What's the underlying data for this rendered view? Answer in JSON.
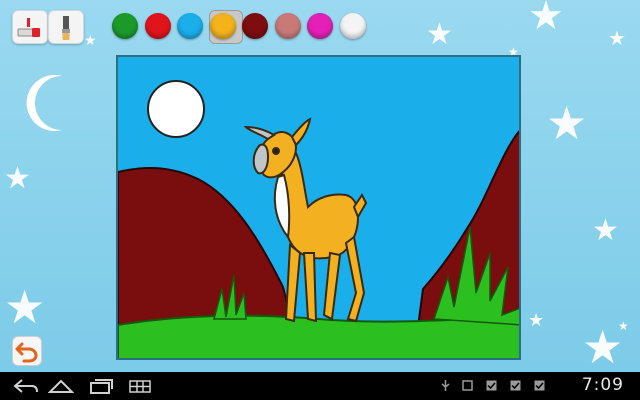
{
  "toolbar": {
    "tools": [
      {
        "name": "marker-tool",
        "icon": "marker-icon"
      },
      {
        "name": "brush-tool",
        "icon": "paint-brush-icon"
      }
    ],
    "palette": [
      {
        "name": "green",
        "color": "#1b9a2a"
      },
      {
        "name": "red",
        "color": "#e1141c"
      },
      {
        "name": "cyan",
        "color": "#1aaeea"
      },
      {
        "name": "yellow",
        "color": "#f4b21b",
        "selected": true
      },
      {
        "name": "maroon",
        "color": "#7d0d10"
      },
      {
        "name": "rose",
        "color": "#c97a78"
      },
      {
        "name": "magenta",
        "color": "#e321b8"
      },
      {
        "name": "white",
        "color": "#f4f4f4"
      }
    ]
  },
  "canvas": {
    "sky_color": "#1aaeea",
    "hill_color": "#7a0e0e",
    "grass_color": "#2bbf1f",
    "deer_color": "#f3b021"
  },
  "undo": {
    "icon": "undo-arrow-icon"
  },
  "system_bar": {
    "clock": "7:09",
    "nav_icons": [
      "back-icon",
      "home-icon",
      "recent-apps-icon",
      "menu-icon"
    ],
    "status_icons": [
      "usb-icon",
      "notification-icon",
      "checkbox-icon",
      "checkbox-icon",
      "checkbox-icon"
    ]
  }
}
